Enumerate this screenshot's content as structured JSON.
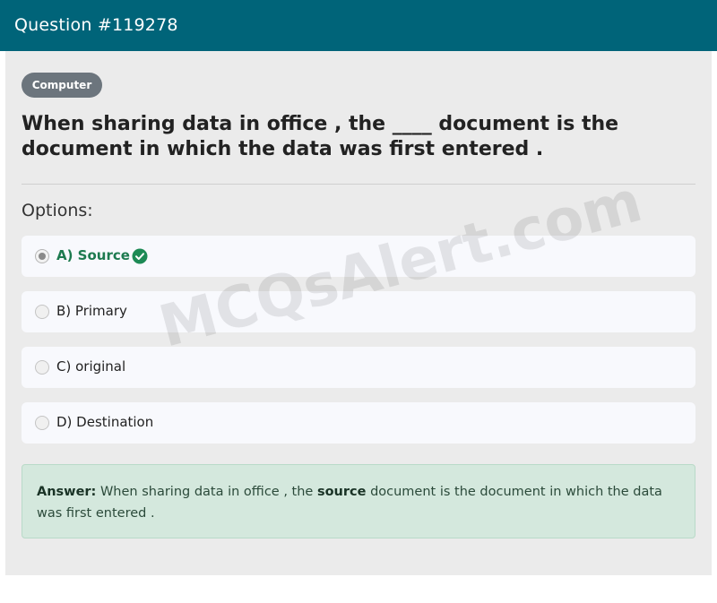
{
  "header": {
    "title": "Question #119278"
  },
  "category": {
    "label": "Computer"
  },
  "question": {
    "text": "When sharing data in office , the ____ document is the document in which the data was first entered ."
  },
  "options_heading": "Options:",
  "options": [
    {
      "label": "A) Source",
      "selected": true,
      "correct": true
    },
    {
      "label": "B) Primary",
      "selected": false,
      "correct": false
    },
    {
      "label": "C) original",
      "selected": false,
      "correct": false
    },
    {
      "label": "D) Destination",
      "selected": false,
      "correct": false
    }
  ],
  "answer": {
    "prefix": "Answer:",
    "text_before": "When sharing data in office , the",
    "highlight": "source",
    "text_after": "document is the document in which the data was first entered ."
  },
  "watermark": "MCQsAlert.com",
  "colors": {
    "header": "#006479",
    "correct": "#1d7a4f",
    "answer_bg": "#d4e8dd"
  },
  "icons": {
    "correct": "check-circle-icon"
  }
}
